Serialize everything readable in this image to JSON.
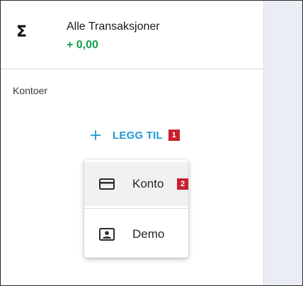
{
  "sidebar": {
    "all_transactions": {
      "icon": "sigma-icon",
      "symbol": "Σ",
      "title": "Alle Transaksjoner",
      "amount": "+ 0,00",
      "amount_color": "#11a04b"
    },
    "section_label": "Kontoer",
    "add_button": {
      "icon": "plus-icon",
      "label": "LEGG TIL",
      "color": "#1d9ad6",
      "callout": "1"
    }
  },
  "dropdown": {
    "items": [
      {
        "icon": "credit-card-icon",
        "label": "Konto",
        "callout": "2",
        "highlighted": true
      },
      {
        "icon": "contact-card-icon",
        "label": "Demo",
        "highlighted": false
      }
    ]
  },
  "colors": {
    "callout_badge": "#c8202f",
    "content_background": "#ebedf4"
  }
}
